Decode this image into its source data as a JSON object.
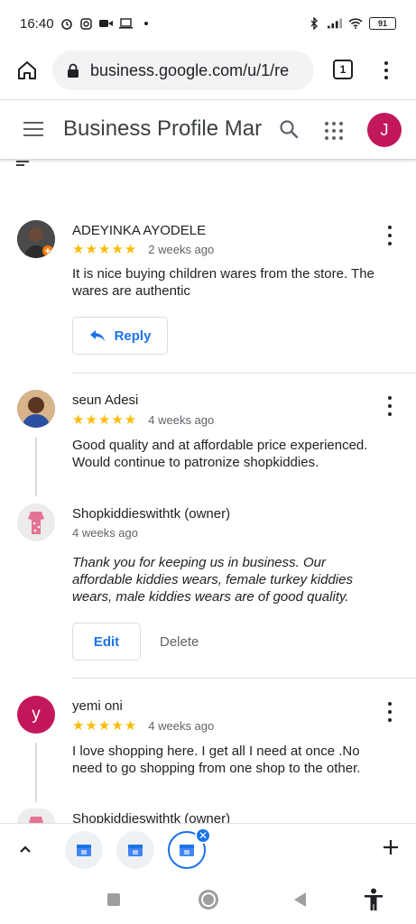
{
  "status_bar": {
    "time": "16:40",
    "battery": "91",
    "left_icons": [
      "alarm-icon",
      "instagram-icon",
      "video-icon",
      "laptop-icon",
      "dot-icon"
    ],
    "right_icons": [
      "bluetooth-icon",
      "signal-icon",
      "wifi-icon",
      "battery-icon"
    ]
  },
  "browser": {
    "url": "business.google.com/u/1/re",
    "tab_count": "1"
  },
  "app_header": {
    "title": "Business Profile Mar",
    "avatar_letter": "J",
    "avatar_color": "#c2185b"
  },
  "reviews": [
    {
      "name": "ADEYINKA AYODELE",
      "stars": "★★★★★",
      "time": "2 weeks ago",
      "text": "It is nice buying children wares from the store. The wares are authentic",
      "reply_button": "Reply"
    },
    {
      "name": "seun Adesi",
      "stars": "★★★★★",
      "time": "4 weeks ago",
      "text": "Good quality and at affordable price experienced. Would continue to patronize shopkiddies.",
      "owner_reply": {
        "name": "Shopkiddieswithtk (owner)",
        "time": "4 weeks ago",
        "text": "Thank you for keeping us in business. Our affordable kiddies wears, female turkey kiddies wears, male kiddies wears are of good quality."
      },
      "edit_label": "Edit",
      "delete_label": "Delete"
    },
    {
      "name": "yemi oni",
      "avatar_letter": "y",
      "avatar_color": "#c2185b",
      "stars": "★★★★★",
      "time": "4 weeks ago",
      "text": "I love shopping here. I get all I need at once .No need to go shopping from one shop to the other.",
      "owner_reply": {
        "name": "Shopkiddieswithtk (owner)"
      }
    }
  ],
  "colors": {
    "star": "#fbbc04",
    "accent": "#1a73e8"
  }
}
